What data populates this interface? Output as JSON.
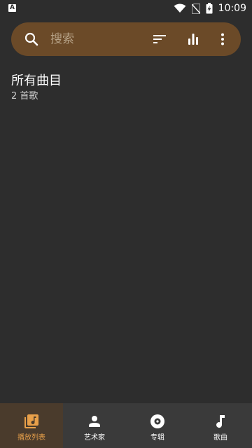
{
  "status_bar": {
    "notification_glyph": "A",
    "time": "10:09",
    "icons": [
      "wifi-icon",
      "no-sim-icon",
      "battery-charging-icon"
    ]
  },
  "search": {
    "placeholder": "搜索",
    "icons": [
      "search-icon",
      "sort-icon",
      "equalizer-icon",
      "more-vert-icon"
    ]
  },
  "playlist": {
    "title": "所有曲目",
    "count": "2 首歌"
  },
  "bottom_nav": {
    "items": [
      {
        "label": "播放列表",
        "icon": "playlist-icon",
        "active": true
      },
      {
        "label": "艺术家",
        "icon": "artist-icon",
        "active": false
      },
      {
        "label": "专辑",
        "icon": "album-icon",
        "active": false
      },
      {
        "label": "歌曲",
        "icon": "music-note-icon",
        "active": false
      }
    ]
  },
  "colors": {
    "background": "#2d2d2d",
    "search_bar": "#6b4a28",
    "accent": "#e8a04a",
    "nav_bar": "#3a3a3a"
  }
}
